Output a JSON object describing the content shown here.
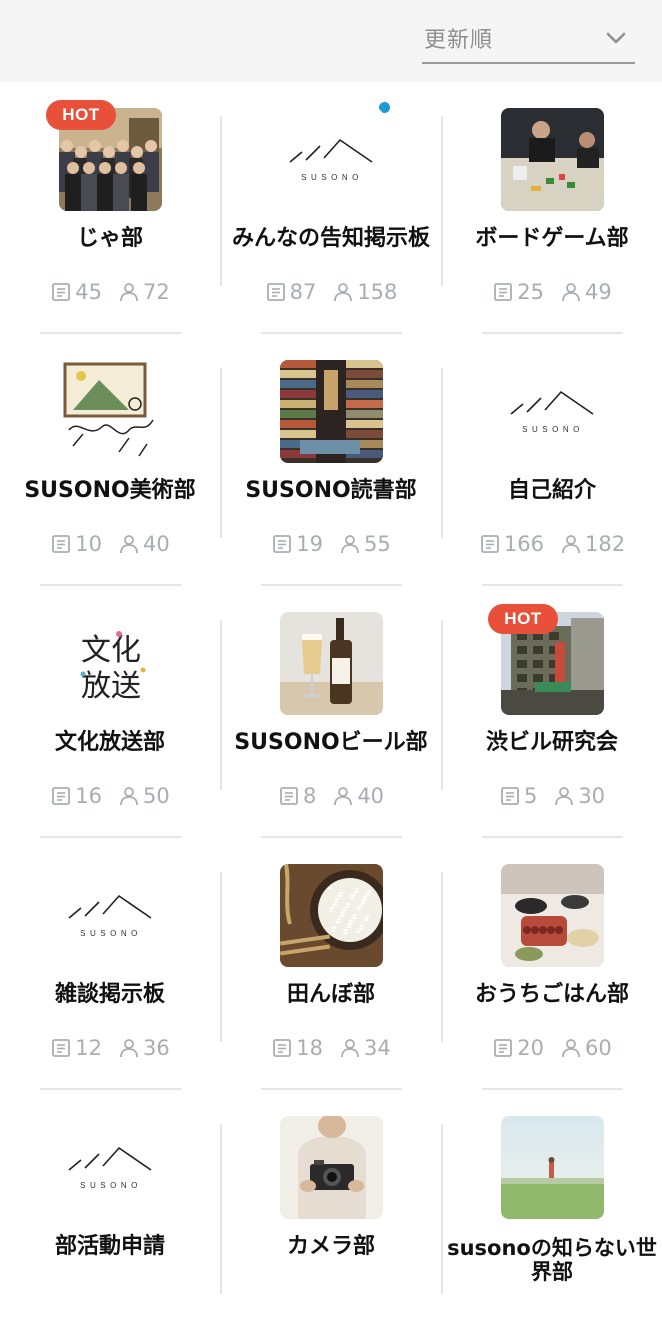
{
  "sort": {
    "label": "更新順"
  },
  "hot_label": "HOT",
  "groups": [
    {
      "title": "じゃ部",
      "posts": "45",
      "members": "72",
      "thumb": "photo-people",
      "hot": true
    },
    {
      "title": "みんなの告知掲示板",
      "posts": "87",
      "members": "158",
      "thumb": "susono-logo",
      "dot": true
    },
    {
      "title": "ボードゲーム部",
      "posts": "25",
      "members": "49",
      "thumb": "photo-boardgame"
    },
    {
      "title": "SUSONO美術部",
      "posts": "10",
      "members": "40",
      "thumb": "illustration-art"
    },
    {
      "title": "SUSONO読書部",
      "posts": "19",
      "members": "55",
      "thumb": "photo-books"
    },
    {
      "title": "自己紹介",
      "posts": "166",
      "members": "182",
      "thumb": "susono-logo"
    },
    {
      "title": "文化放送部",
      "posts": "16",
      "members": "50",
      "thumb": "text-logo-bunka"
    },
    {
      "title": "SUSONOビール部",
      "posts": "8",
      "members": "40",
      "thumb": "photo-beer"
    },
    {
      "title": "渋ビル研究会",
      "posts": "5",
      "members": "30",
      "thumb": "photo-building",
      "hot": true
    },
    {
      "title": "雑談掲示板",
      "posts": "12",
      "members": "36",
      "thumb": "susono-logo"
    },
    {
      "title": "田んぼ部",
      "posts": "18",
      "members": "34",
      "thumb": "photo-rice"
    },
    {
      "title": "おうちごはん部",
      "posts": "20",
      "members": "60",
      "thumb": "photo-food"
    },
    {
      "title": "部活動申請",
      "posts": "",
      "members": "",
      "thumb": "susono-logo"
    },
    {
      "title": "カメラ部",
      "posts": "",
      "members": "",
      "thumb": "photo-camera"
    },
    {
      "title": "susonoの知らない世界部",
      "posts": "",
      "members": "",
      "thumb": "photo-field"
    }
  ],
  "logo": {
    "wordmark": "SUSONO"
  },
  "bunka_logo": {
    "line1": "文化",
    "line2": "放送"
  },
  "colors": {
    "hot": "#e8503a",
    "dot": "#1a9bd6",
    "stat": "#a9adb3"
  }
}
